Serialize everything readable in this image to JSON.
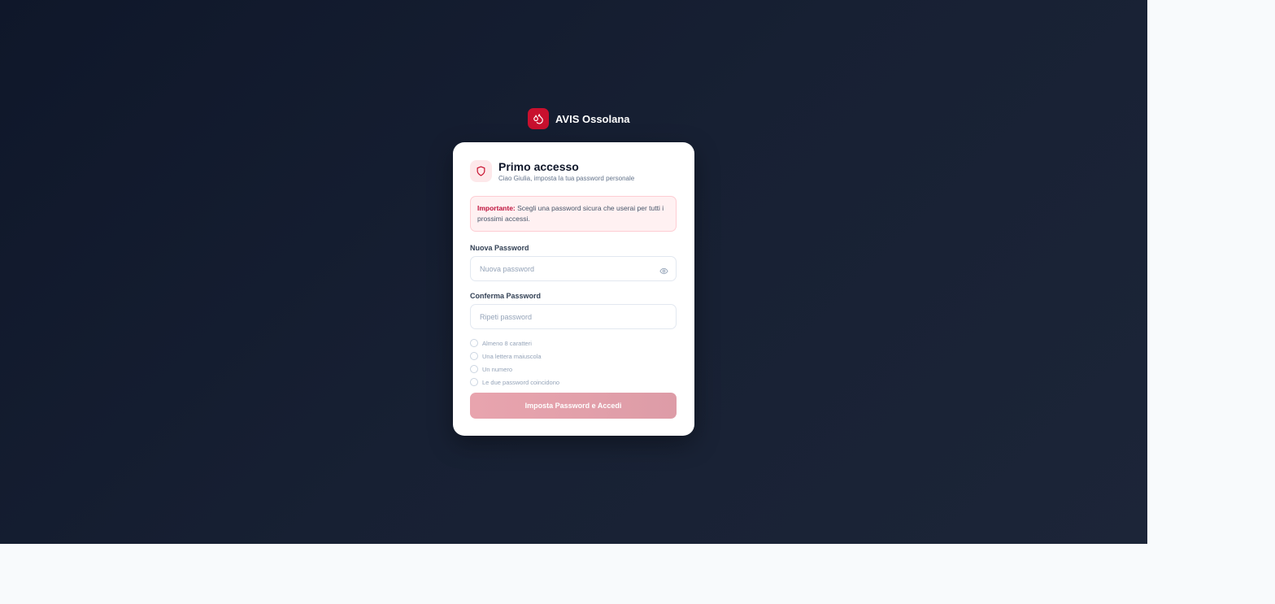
{
  "brand": {
    "name": "AVIS Ossolana",
    "color": "#c8102e"
  },
  "card": {
    "title": "Primo accesso",
    "subtitle": "Ciao Giulia, imposta la tua password personale",
    "alert": {
      "strong": "Importante:",
      "text": " Scegli una password sicura che userai per tutti i prossimi accessi."
    },
    "new_password": {
      "label": "Nuova Password",
      "placeholder": "Nuova password"
    },
    "confirm_password": {
      "label": "Conferma Password",
      "placeholder": "Ripeti password"
    },
    "requirements": [
      "Almeno 8 caratteri",
      "Una lettera maiuscola",
      "Un numero",
      "Le due password coincidono"
    ],
    "submit_label": "Imposta Password e Accedi"
  },
  "icons": {
    "logo": "blood-drop-icon",
    "shield": "shield-icon",
    "eye": "eye-icon"
  }
}
